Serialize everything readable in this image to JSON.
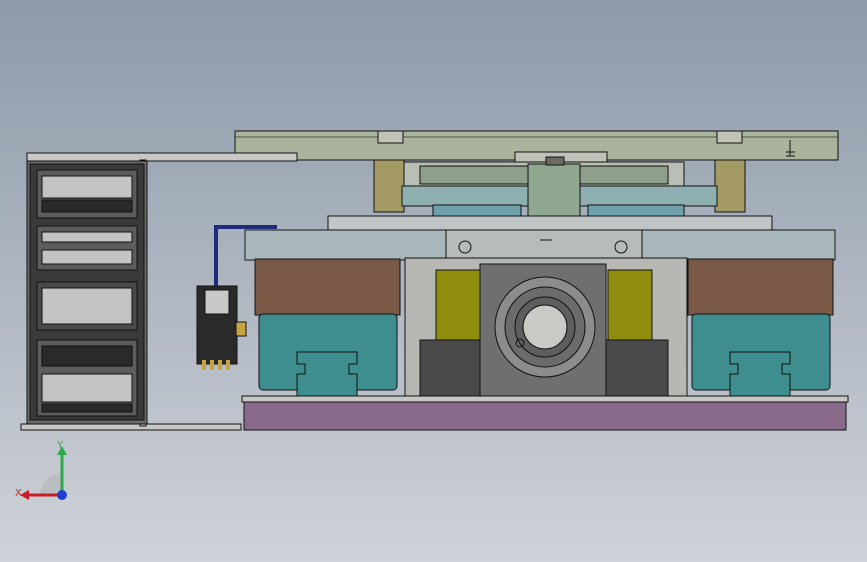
{
  "viewport": {
    "background_top": "#8e9aaa",
    "background_bottom": "#cfd2d8"
  },
  "colors": {
    "outline": "#111111",
    "frame": "#c8c9c6",
    "cable_chain": "#3a3a3a",
    "top_plate": "#aab39c",
    "clamp": "#a39a64",
    "glass_plate": "#a9b9bd",
    "blue_plate": "#6fa1ad",
    "brown_block": "#7a5a47",
    "teal_block": "#3e8e8f",
    "yellow_block": "#8e8d0e",
    "dark_block": "#4a4a4a",
    "gray_block": "#6f6f6f",
    "bearing_ring": "#8c8c8c",
    "bearing_hole": "#c9c9c6",
    "base_plate": "#8a6a8b",
    "sensor_wire": "#1f2a7a",
    "sensor_body": "#2a2a2a",
    "pin": "#c7a440"
  },
  "triad": {
    "y_label": "Y",
    "x_label": "X",
    "y_color": "#2fa84a",
    "x_color": "#c81e24",
    "z_color": "#1f3ecf"
  }
}
